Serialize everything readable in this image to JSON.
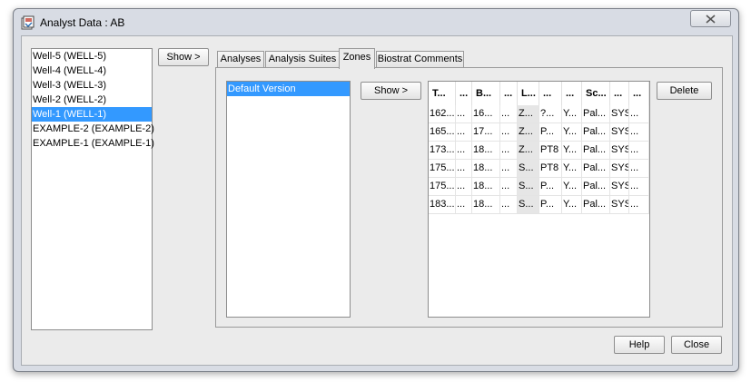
{
  "window": {
    "title": "Analyst Data : AB"
  },
  "wells": [
    {
      "label": "Well-5 (WELL-5)",
      "selected": false
    },
    {
      "label": "Well-4 (WELL-4)",
      "selected": false
    },
    {
      "label": "Well-3 (WELL-3)",
      "selected": false
    },
    {
      "label": "Well-2 (WELL-2)",
      "selected": false
    },
    {
      "label": "Well-1 (WELL-1)",
      "selected": true
    },
    {
      "label": "EXAMPLE-2 (EXAMPLE-2)",
      "selected": false
    },
    {
      "label": "EXAMPLE-1 (EXAMPLE-1)",
      "selected": false
    }
  ],
  "show_wells_label": "Show >",
  "tabs": [
    {
      "label": "Analyses",
      "active": false
    },
    {
      "label": "Analysis Suites",
      "active": false
    },
    {
      "label": "Zones",
      "active": true
    },
    {
      "label": "Biostrat Comments",
      "active": false
    }
  ],
  "versions": [
    {
      "label": "Default Version",
      "selected": true
    }
  ],
  "show_versions_label": "Show >",
  "delete_label": "Delete",
  "grid": {
    "headers": [
      "T...",
      "...",
      "B...",
      "...",
      "L...",
      "...",
      "...",
      "Sc...",
      "...",
      "..."
    ],
    "shaded_column": 4,
    "rows": [
      [
        "162...",
        "...",
        "16...",
        "...",
        "Z...",
        "?...",
        "Y...",
        "Pal...",
        "SYS",
        "..."
      ],
      [
        "165...",
        "...",
        "17...",
        "...",
        "Z...",
        "P...",
        "Y...",
        "Pal...",
        "SYS",
        "..."
      ],
      [
        "173...",
        "...",
        "18...",
        "...",
        "Z...",
        "PT8",
        "Y...",
        "Pal...",
        "SYS",
        "..."
      ],
      [
        "175...",
        "...",
        "18...",
        "...",
        "S...",
        "PT8",
        "Y...",
        "Pal...",
        "SYS",
        "..."
      ],
      [
        "175...",
        "...",
        "18...",
        "...",
        "S...",
        "P...",
        "Y...",
        "Pal...",
        "SYS",
        "..."
      ],
      [
        "183...",
        "...",
        "18...",
        "...",
        "S...",
        "P...",
        "Y...",
        "Pal...",
        "SYS",
        "..."
      ]
    ]
  },
  "help_label": "Help",
  "close_label": "Close"
}
